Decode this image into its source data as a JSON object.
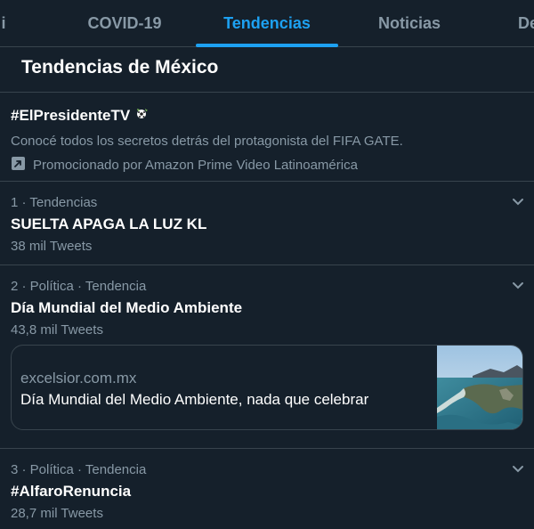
{
  "tabs": [
    {
      "label": "i"
    },
    {
      "label": "COVID-19"
    },
    {
      "label": "Tendencias"
    },
    {
      "label": "Noticias"
    },
    {
      "label": "De"
    }
  ],
  "section_title": "Tendencias de México",
  "promoted": {
    "hashtag": "#ElPresidenteTV",
    "emoji_icon": "soccer-ball-icon",
    "description": "Conocé todos los secretos detrás del protagonista del FIFA GATE.",
    "promoted_by": "Promocionado por Amazon Prime Video Latinoamérica"
  },
  "trends": [
    {
      "meta": "1 · Tendencias",
      "name": "SUELTA APAGA LA LUZ KL",
      "count": "38 mil Tweets"
    },
    {
      "meta": "2 · Política · Tendencia",
      "name": "Día Mundial del Medio Ambiente",
      "count": "43,8 mil Tweets"
    },
    {
      "meta": "3 · Política · Tendencia",
      "name": "#AlfaroRenuncia",
      "count": "28,7 mil Tweets"
    }
  ],
  "card": {
    "domain": "excelsior.com.mx",
    "title": "Día Mundial del Medio Ambiente, nada que celebrar",
    "thumbnail": "coastal-landscape-image"
  },
  "colors": {
    "background": "#15202b",
    "accent": "#1da1f2",
    "secondary_text": "#8899a6",
    "border": "#38444d"
  }
}
